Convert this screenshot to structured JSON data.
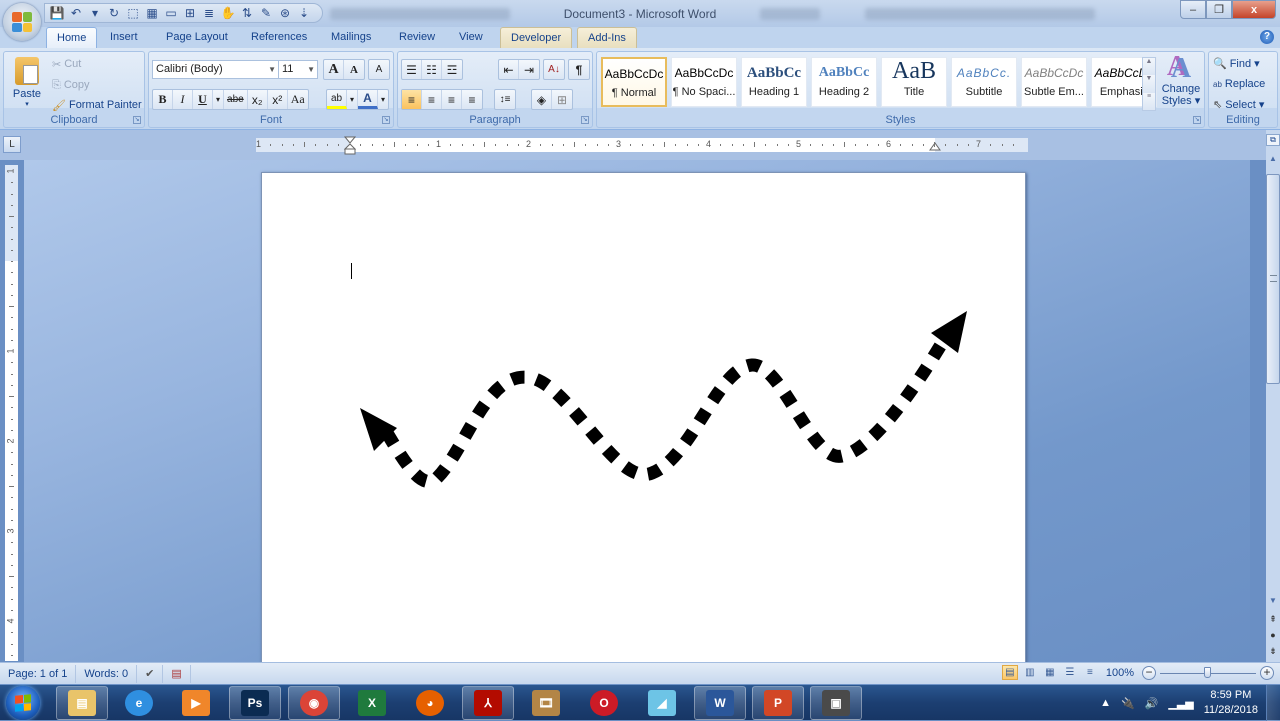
{
  "window": {
    "title": "Document3 - Microsoft Word",
    "controls": {
      "minimize": "–",
      "maximize": "❐",
      "close": "x"
    }
  },
  "quick_access": [
    {
      "name": "save-icon",
      "glyph": "💾"
    },
    {
      "name": "undo-icon",
      "glyph": "↶"
    },
    {
      "name": "undo-dropdown-icon",
      "glyph": "▾"
    },
    {
      "name": "redo-icon",
      "glyph": "↻"
    },
    {
      "name": "select-objects-icon",
      "glyph": "⬚"
    },
    {
      "name": "form-field-icon",
      "glyph": "▦"
    },
    {
      "name": "text-box-icon",
      "glyph": "▭"
    },
    {
      "name": "insert-table-icon",
      "glyph": "⊞"
    },
    {
      "name": "page-break-icon",
      "glyph": "≣"
    },
    {
      "name": "hand-icon",
      "glyph": "✋"
    },
    {
      "name": "sort-icon",
      "glyph": "⇅"
    },
    {
      "name": "tools-icon",
      "glyph": "✎"
    },
    {
      "name": "macro-icon",
      "glyph": "⊛"
    },
    {
      "name": "customize-qat-icon",
      "glyph": "⇣"
    }
  ],
  "tabs": [
    {
      "label": "Home",
      "active": true
    },
    {
      "label": "Insert"
    },
    {
      "label": "Page Layout"
    },
    {
      "label": "References"
    },
    {
      "label": "Mailings"
    },
    {
      "label": "Review"
    },
    {
      "label": "View"
    },
    {
      "label": "Developer",
      "contextual": true
    },
    {
      "label": "Add-Ins",
      "contextual": true
    }
  ],
  "ribbon": {
    "clipboard": {
      "label": "Clipboard",
      "paste": "Paste",
      "cut": "Cut",
      "copy": "Copy",
      "format_painter": "Format Painter"
    },
    "font": {
      "label": "Font",
      "font_name": "Calibri (Body)",
      "font_size": "11",
      "grow": "A",
      "shrink": "A",
      "clear": "A",
      "bold": "B",
      "italic": "I",
      "underline": "U",
      "strike": "abe",
      "subscript": "x₂",
      "superscript": "x²",
      "change_case": "Aa",
      "highlight": "ab",
      "font_color": "A"
    },
    "paragraph": {
      "label": "Paragraph",
      "bullets": "☰",
      "numbering": "☷",
      "multilevel": "☲",
      "decrease_indent": "⇤",
      "increase_indent": "⇥",
      "sort": "A↓",
      "show_marks": "¶",
      "align_left": "≡",
      "center": "≡",
      "align_right": "≡",
      "justify": "≡",
      "line_spacing": "↕≡",
      "shading": "◈",
      "borders": "⊞"
    },
    "styles": {
      "label": "Styles",
      "items": [
        {
          "preview": "AaBbCcDc",
          "name": "¶ Normal",
          "selected": true
        },
        {
          "preview": "AaBbCcDc",
          "name": "¶ No Spaci..."
        },
        {
          "preview": "AaBbCc",
          "name": "Heading 1"
        },
        {
          "preview": "AaBbCc",
          "name": "Heading 2"
        },
        {
          "preview": "AaB",
          "name": "Title"
        },
        {
          "preview": "AaBbCc.",
          "name": "Subtitle"
        },
        {
          "preview": "AaBbCcDc",
          "name": "Subtle Em..."
        },
        {
          "preview": "AaBbCcDc",
          "name": "Emphasis"
        }
      ],
      "change_styles_line1": "Change",
      "change_styles_line2": "Styles ▾"
    },
    "editing": {
      "label": "Editing",
      "find": "Find ▾",
      "replace": "Replace",
      "select": "Select ▾"
    }
  },
  "ruler": {
    "labels": [
      "1",
      "1",
      "2",
      "3",
      "4",
      "5",
      "6",
      "7"
    ]
  },
  "vruler": {
    "labels": [
      "1",
      "1",
      "2",
      "3",
      "4"
    ]
  },
  "document": {
    "shape": "curved dotted double-headed arrow",
    "shape_color": "#000000"
  },
  "status_bar": {
    "page": "Page: 1 of 1",
    "words": "Words: 0",
    "zoom": "100%",
    "zoom_level_percent": 100
  },
  "taskbar": {
    "apps": [
      {
        "name": "file-explorer",
        "label": "",
        "color": "#e9c46a",
        "glyph": "▤"
      },
      {
        "name": "internet-explorer",
        "label": "",
        "color": "#2f8fe0",
        "glyph": "e"
      },
      {
        "name": "media-player",
        "label": "",
        "color": "#f0862a",
        "glyph": "▶"
      },
      {
        "name": "photoshop",
        "label": "Ps",
        "color": "#0b2b52",
        "glyph": "Ps"
      },
      {
        "name": "chrome",
        "label": "",
        "color": "#db4437",
        "glyph": "◉"
      },
      {
        "name": "excel",
        "label": "",
        "color": "#1f7a3d",
        "glyph": "X"
      },
      {
        "name": "firefox",
        "label": "",
        "color": "#e66000",
        "glyph": "◕"
      },
      {
        "name": "acrobat",
        "label": "",
        "color": "#b30b00",
        "glyph": "⅄"
      },
      {
        "name": "video-editor",
        "label": "",
        "color": "#b38546",
        "glyph": "🎞"
      },
      {
        "name": "opera",
        "label": "",
        "color": "#cc1b26",
        "glyph": "O"
      },
      {
        "name": "notepad",
        "label": "",
        "color": "#6dc4e6",
        "glyph": "◢"
      },
      {
        "name": "word",
        "label": "",
        "color": "#2b579a",
        "glyph": "W"
      },
      {
        "name": "powerpoint",
        "label": "",
        "color": "#d24726",
        "glyph": "P"
      },
      {
        "name": "screen-recorder",
        "label": "",
        "color": "#4a4a4a",
        "glyph": "▣"
      }
    ],
    "time": "8:59 PM",
    "date": "11/28/2018"
  }
}
